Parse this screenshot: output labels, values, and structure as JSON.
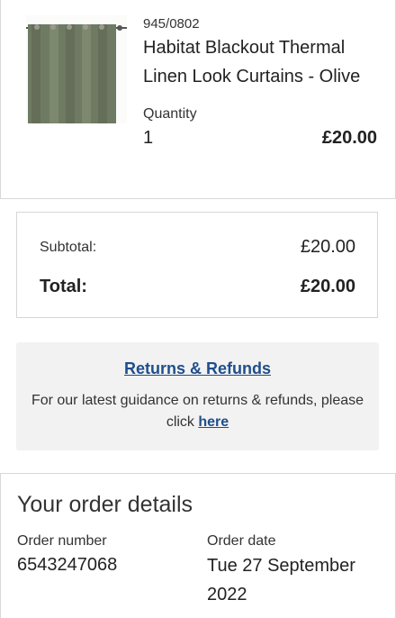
{
  "product": {
    "sku": "945/0802",
    "name": "Habitat Blackout Thermal Linen Look Curtains - Olive",
    "quantity_label": "Quantity",
    "quantity": "1",
    "price": "£20.00",
    "image_icon": "curtain-product-image",
    "curtain_color": "#6f7a62"
  },
  "totals": {
    "subtotal_label": "Subtotal:",
    "subtotal_value": "£20.00",
    "total_label": "Total:",
    "total_value": "£20.00"
  },
  "returns": {
    "title": "Returns & Refunds",
    "body_text": "For our latest guidance on returns & refunds, please click",
    "link_text": "here",
    "link_color": "#1f4e8c"
  },
  "order": {
    "heading": "Your order details",
    "number_label": "Order number",
    "number_value": "6543247068",
    "date_label": "Order date",
    "date_value": "Tue 27 September 2022"
  }
}
